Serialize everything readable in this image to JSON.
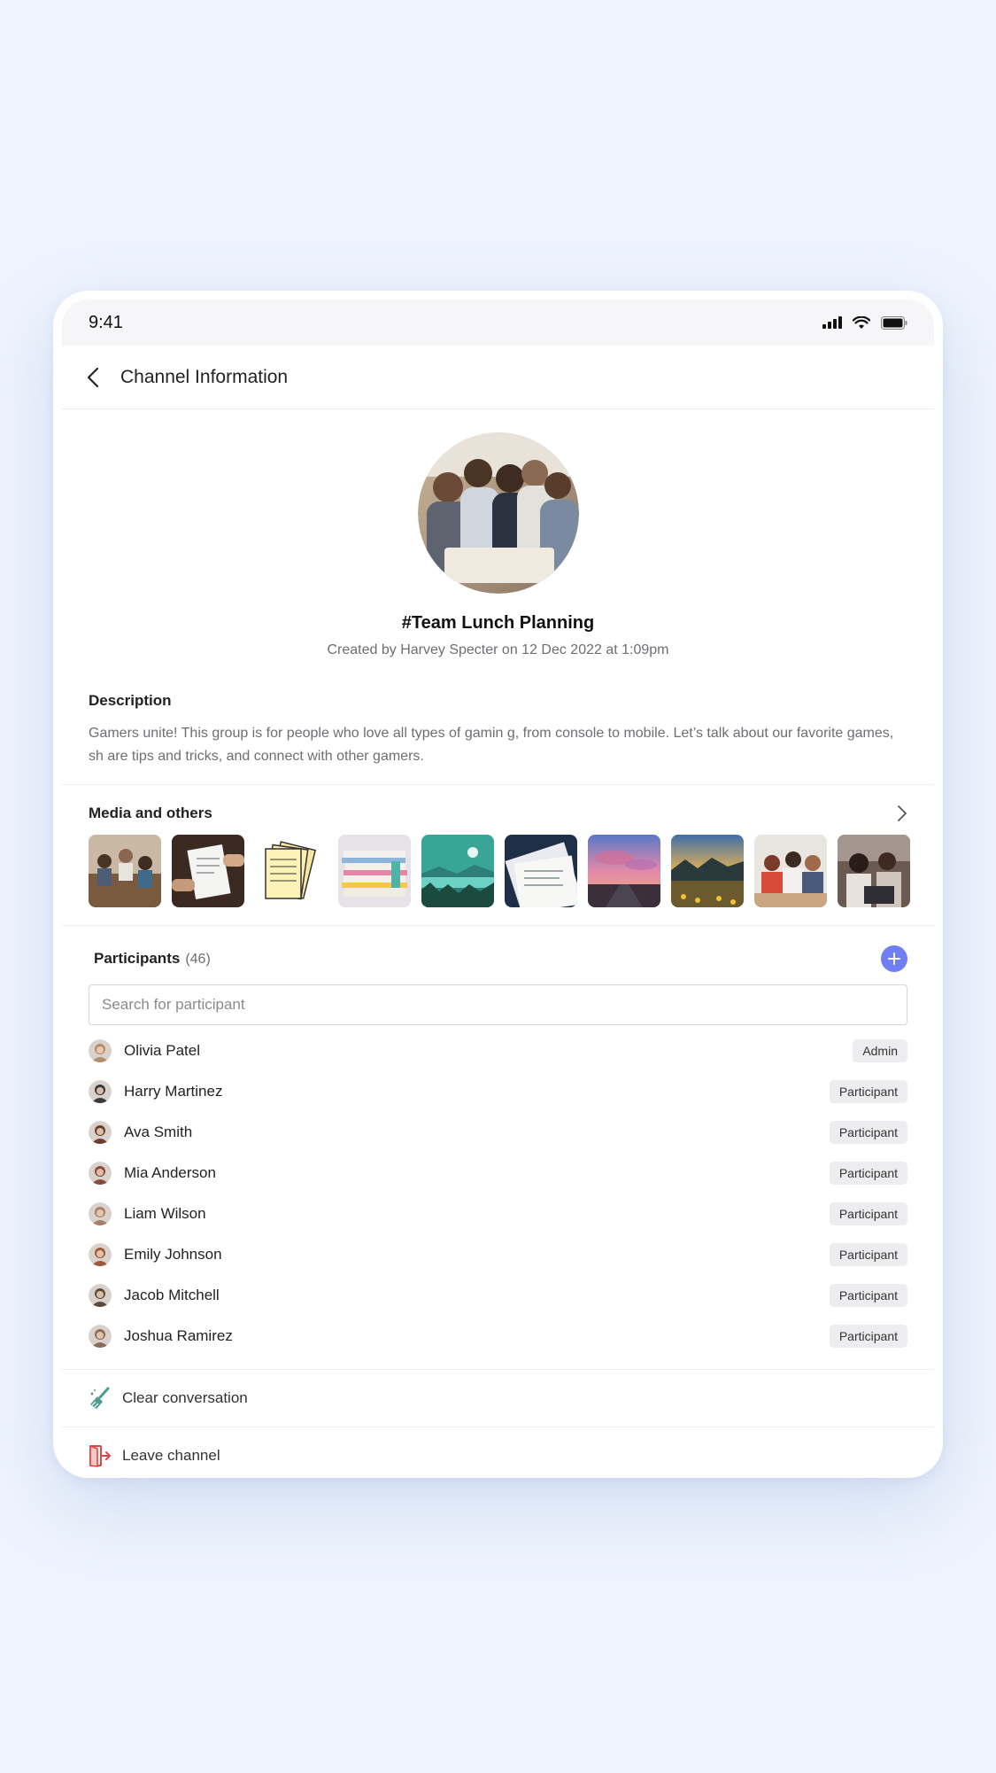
{
  "status_bar": {
    "time": "9:41"
  },
  "nav": {
    "title": "Channel Information"
  },
  "channel": {
    "name": "#Team Lunch Planning",
    "created": "Created by Harvey Specter on 12 Dec 2022 at 1:09pm"
  },
  "description": {
    "title": "Description",
    "text": "Gamers unite! This group is for people who love all types of gamin g, from console to mobile. Let’s talk about our favorite games, sh are tips and tricks, and connect with other gamers."
  },
  "media": {
    "title": "Media and others",
    "items": [
      "team-meeting-photo",
      "document-handoff-photo",
      "notes-papers",
      "file-stacks",
      "lake-landscape",
      "printed-documents",
      "sunset-road",
      "lake-sunset",
      "office-team-photo",
      "women-laptop-photo"
    ]
  },
  "participants": {
    "title": "Participants",
    "count": "(46)",
    "search_placeholder": "Search for participant",
    "list": [
      {
        "name": "Olivia Patel",
        "role": "Admin",
        "color": "#b58c6a"
      },
      {
        "name": "Harry Martinez",
        "role": "Participant",
        "color": "#3a3a3a"
      },
      {
        "name": "Ava Smith",
        "role": "Participant",
        "color": "#6b3e2e"
      },
      {
        "name": "Mia Anderson",
        "role": "Participant",
        "color": "#8a4b3a"
      },
      {
        "name": "Liam Wilson",
        "role": "Participant",
        "color": "#a77f66"
      },
      {
        "name": "Emily Johnson",
        "role": "Participant",
        "color": "#9a5a3c"
      },
      {
        "name": "Jacob Mitchell",
        "role": "Participant",
        "color": "#5b4a3e"
      },
      {
        "name": "Joshua Ramirez",
        "role": "Participant",
        "color": "#8c6d5a"
      }
    ]
  },
  "actions": {
    "clear": "Clear conversation",
    "leave": "Leave channel"
  },
  "colors": {
    "accent": "#6f7ef2",
    "danger": "#e0463f",
    "broom": "#4f9b8f"
  }
}
